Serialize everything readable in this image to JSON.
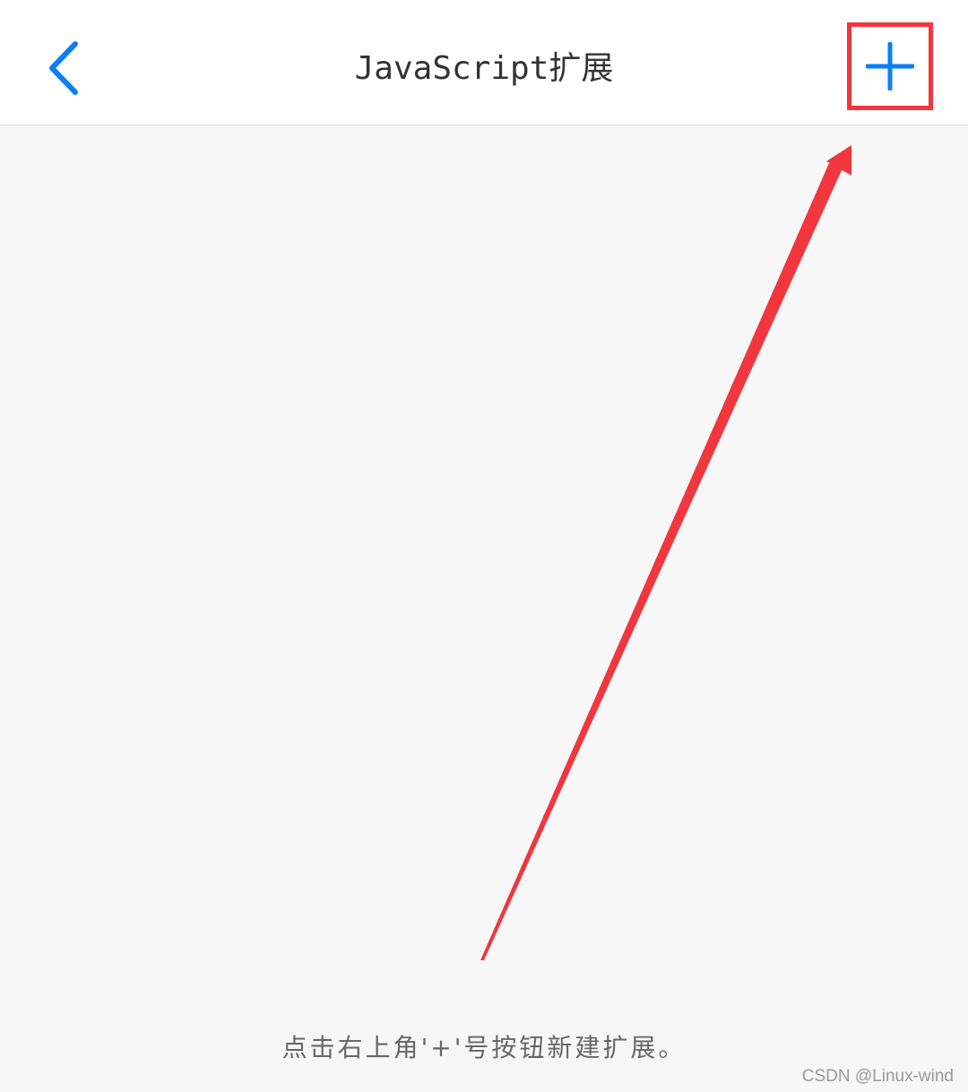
{
  "header": {
    "title": "JavaScript扩展",
    "back_icon": "chevron-left-icon",
    "add_icon": "plus-icon",
    "accent_color": "#0a7ff5"
  },
  "annotation": {
    "highlight_color": "#f1363d",
    "arrow_color": "#f1363d"
  },
  "main": {
    "empty_hint": "点击右上角'+'号按钮新建扩展。"
  },
  "watermark": {
    "text": "CSDN @Linux-wind"
  }
}
